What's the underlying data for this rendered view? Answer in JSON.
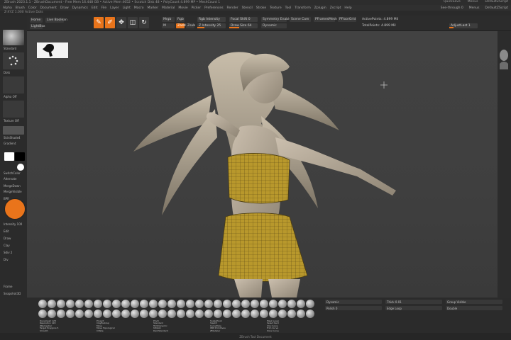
{
  "titlebar": {
    "title": "ZBrush 2023.1.1 - ZBrushDocument - Free Mem 16.448 GB • Active Mem 4652 • Scratch Disk 48 • PolyCount 4.899 MP • MeshCount 1",
    "quick_save": "QuickSave",
    "menus_label": "Menus",
    "default_script": "DefaultZScript"
  },
  "menubar": {
    "items": [
      "Alpha",
      "Brush",
      "Color",
      "Document",
      "Draw",
      "Dynamics",
      "Edit",
      "File",
      "Layer",
      "Light",
      "Macro",
      "Marker",
      "Material",
      "Movie",
      "Picker",
      "Preferences",
      "Render",
      "Stencil",
      "Stroke",
      "Texture",
      "Tool",
      "Transform",
      "Zplugin",
      "Zscript",
      "Help"
    ],
    "right": [
      "See-through 0",
      "Menus",
      "DefaultZScript"
    ]
  },
  "subbar": {
    "text": "Z-XYZ 1.000 Active Dots"
  },
  "toolbar": {
    "home": "Home",
    "lightbox": "LightBox",
    "live_boolean": "Live Boolean",
    "tools": [
      {
        "name": "edit-tool",
        "glyph": "✎",
        "active": true
      },
      {
        "name": "draw-tool",
        "glyph": "✐",
        "active": true
      },
      {
        "name": "move-tool",
        "glyph": "✥",
        "active": false
      },
      {
        "name": "scale-tool",
        "glyph": "◫",
        "active": false
      },
      {
        "name": "rotate-tool",
        "glyph": "↻",
        "active": false
      }
    ],
    "mrgb": "Mrgb",
    "rgb": "Rgb",
    "m": "M",
    "zadd": "Zadd",
    "zsub": "Zsub",
    "zcut": "Zcut",
    "rgb_intensity": "Rgb Intensity",
    "z_intensity": "Z Intensity 25",
    "focal_shift": "Focal Shift 0",
    "draw_size": "Draw Size 64",
    "dynamic": "Dynamic",
    "active_points": "ActivePoints: 4.899 Mil",
    "total_points": "TotalPoints: 4.899 Mil",
    "adjust_last": "AdjustLast 1",
    "symmetry": "Symmetry Enabled",
    "scene_index": "Scene Cam",
    "polyframe": "PFramesMesh",
    "floor_label": "PFloorGrid"
  },
  "leftshelf": {
    "items": [
      "Standard",
      "Dots",
      "Alpha Off",
      "Texture Off",
      "SkinShade4",
      "Gradient",
      "SwitchColor",
      "Alternate",
      "MergeDown",
      "MergeVisible",
      "BPR",
      "Intensity 100",
      "Edit",
      "Draw",
      "Clay",
      "Sdiv 2",
      "Div",
      "Frame",
      "Snapshot3D"
    ]
  },
  "bottom": {
    "labels": [
      "Dynamesh 128",
      "Resolution 128",
      "ZRemesher",
      "Target Polygons 5",
      "Smooth",
      "Project",
      "ClayBuildup",
      "Move",
      "Move Topological",
      "Inflate",
      "Pinch",
      "Standard",
      "TrimDynamic",
      "hPolish",
      "DamStandard",
      "SnakeHook",
      "Slash3",
      "CurveTube",
      "IMM Primitives",
      "ZModeler",
      "Mask Lasso",
      "Select Rect",
      "Clip Curve",
      "Trim Curve",
      "Slice Curve"
    ],
    "right_labels": [
      "Dynamic",
      "Thick 0.01",
      "Group Visible",
      "Polish 0",
      "Edge Loop",
      "Double"
    ]
  },
  "right_shelf_head": "head-thumbnail",
  "status": "ZBrush Tool Document"
}
